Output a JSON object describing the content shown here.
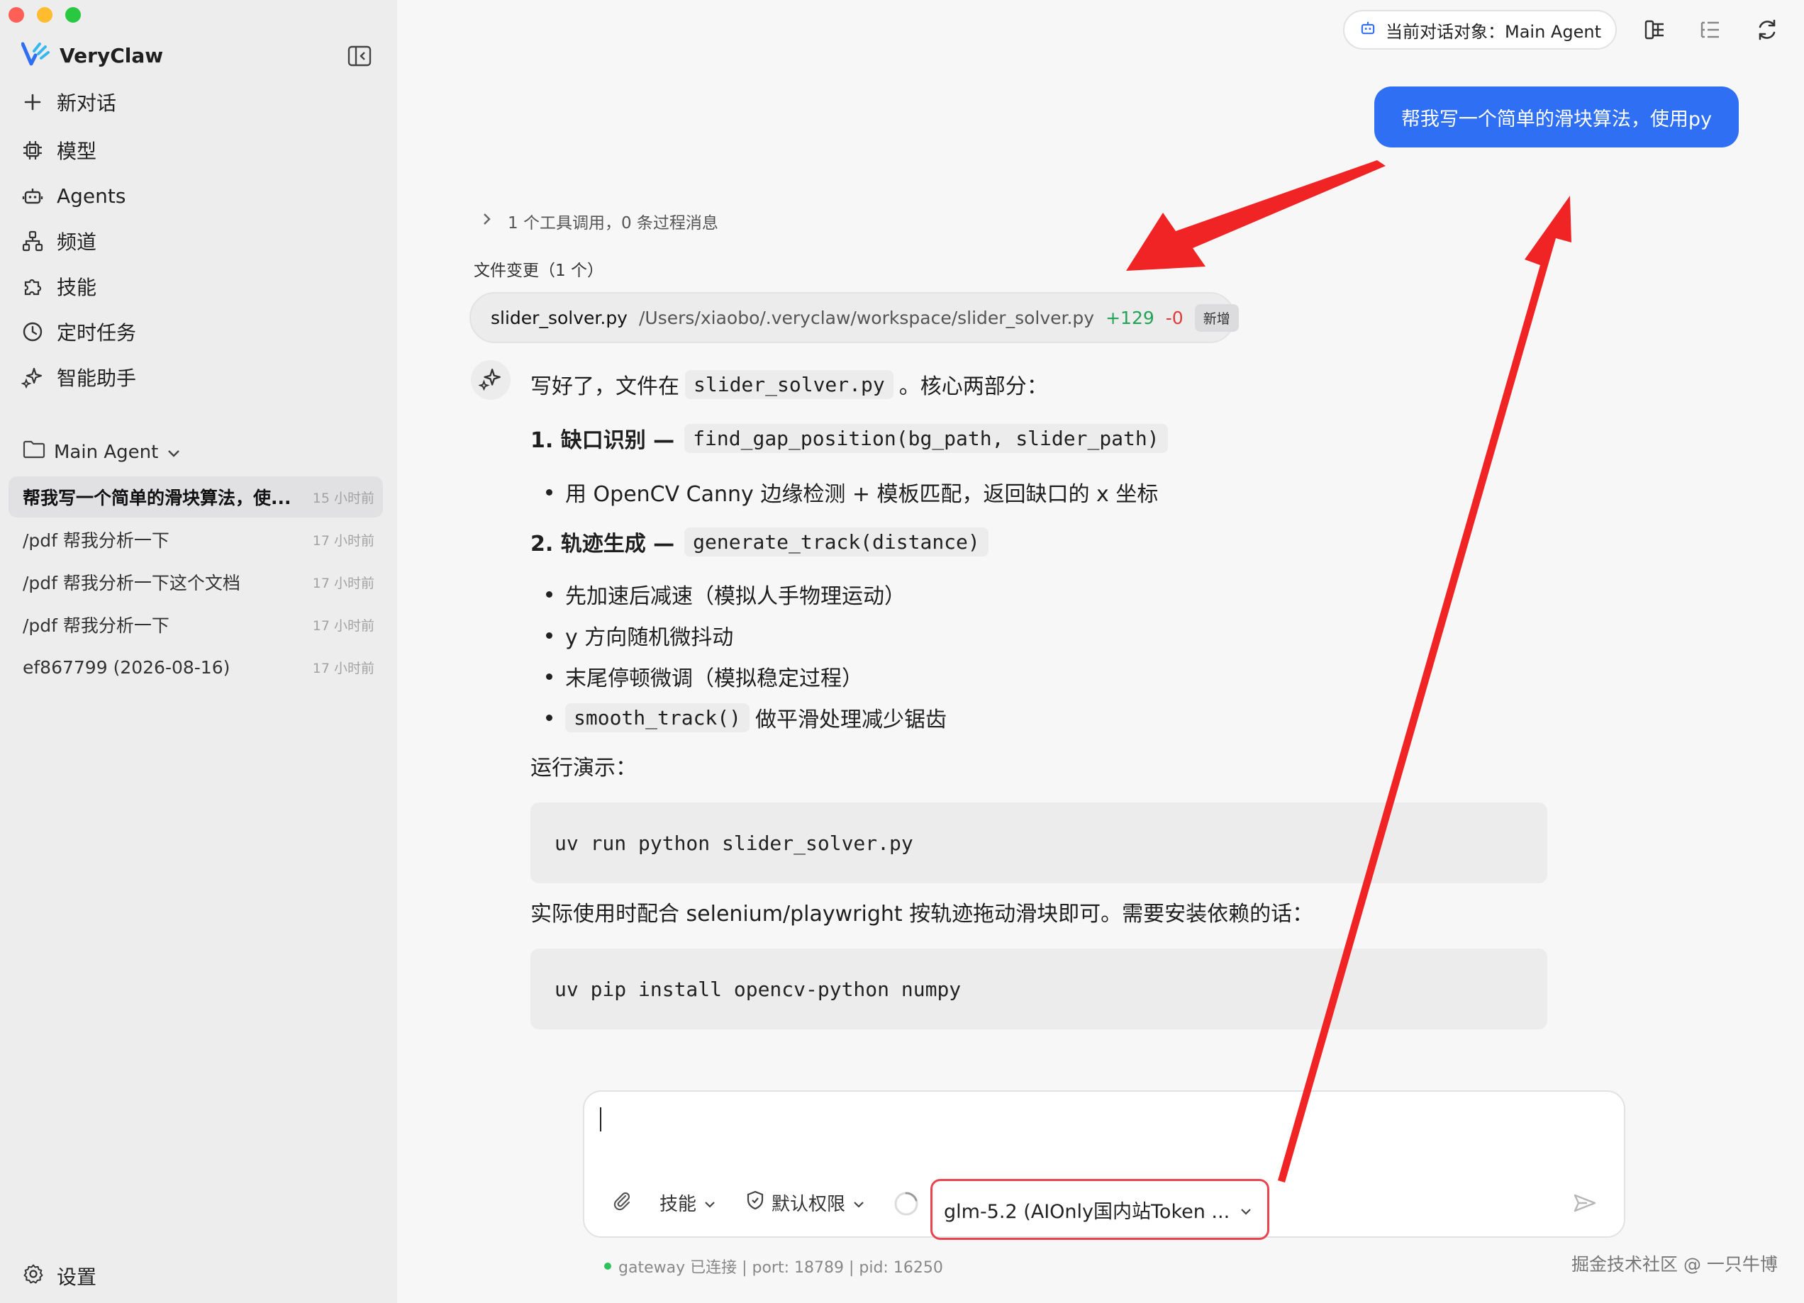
{
  "app": {
    "name": "VeryClaw",
    "colors": {
      "accent": "#2f6ff4",
      "sidebar_bg": "#ededee",
      "highlight": "#e8454f",
      "annotation_arrow": "#f02424"
    }
  },
  "sidebar": {
    "new_chat": "新对话",
    "items": [
      {
        "label": "模型",
        "icon": "chip-icon"
      },
      {
        "label": "Agents",
        "icon": "robot-icon"
      },
      {
        "label": "频道",
        "icon": "channel-tree-icon"
      },
      {
        "label": "技能",
        "icon": "puzzle-icon"
      },
      {
        "label": "定时任务",
        "icon": "clock-icon"
      },
      {
        "label": "智能助手",
        "icon": "sparkle-icon"
      }
    ],
    "group_label": "Main Agent",
    "conversations": [
      {
        "title": "帮我写一个简单的滑块算法，使...",
        "time": "15 小时前",
        "active": true
      },
      {
        "title": "/pdf 帮我分析一下",
        "time": "17 小时前"
      },
      {
        "title": "/pdf 帮我分析一下这个文档",
        "time": "17 小时前"
      },
      {
        "title": "/pdf 帮我分析一下",
        "time": "17 小时前"
      },
      {
        "title": "ef867799 (2026-08-16)",
        "time": "17 小时前"
      }
    ],
    "settings": "设置"
  },
  "header": {
    "target_label": "当前对话对象：Main Agent"
  },
  "chat": {
    "user_message": "帮我写一个简单的滑块算法，使用py",
    "tool_summary": "1 个工具调用，0 条过程消息",
    "file_changes_header": "文件变更（1 个）",
    "file": {
      "name": "slider_solver.py",
      "path": "/Users/xiaobo/.veryclaw/workspace/slider_solver.py",
      "additions": "+129",
      "deletions": "-0",
      "badge": "新增"
    },
    "reply": {
      "intro_before": "写好了，文件在",
      "intro_code": "slider_solver.py",
      "intro_after": "。核心两部分：",
      "section1_title": "1. 缺口识别 —",
      "section1_code": "find_gap_position(bg_path, slider_path)",
      "section1_bullets": [
        "用 OpenCV Canny 边缘检测 + 模板匹配，返回缺口的 x 坐标"
      ],
      "section2_title": "2. 轨迹生成 —",
      "section2_code": "generate_track(distance)",
      "section2_bullets": [
        "先加速后减速（模拟人手物理运动）",
        "y 方向随机微抖动",
        "末尾停顿微调（模拟稳定过程）"
      ],
      "section2_last_code": "smooth_track()",
      "section2_last_text": "做平滑处理减少锯齿",
      "run_label": "运行演示：",
      "code1": "uv run python slider_solver.py",
      "usage_text": "实际使用时配合 selenium/playwright 按轨迹拖动滑块即可。需要安装依赖的话：",
      "code2": "uv pip install opencv-python numpy"
    }
  },
  "composer": {
    "skills_label": "技能",
    "permission_label": "默认权限",
    "model_label": "glm-5.2 (AIOnly国内站Token ..."
  },
  "status": {
    "text": "gateway 已连接 | port: 18789 | pid: 16250"
  },
  "watermark": "掘金技术社区 @ 一只牛博"
}
